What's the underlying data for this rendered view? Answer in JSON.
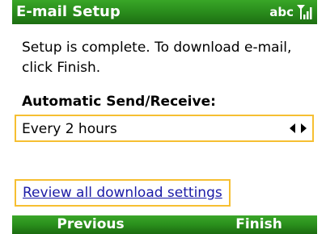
{
  "title_bar": {
    "title": "E-mail Setup",
    "input_mode": "abc",
    "signal_icon": "signal-strength-icon"
  },
  "message": "Setup is complete.  To download e-mail, click Finish.",
  "send_receive": {
    "label": "Automatic Send/Receive:",
    "selected_value": "Every 2 hours",
    "arrows_icon": "left-right-arrows-icon"
  },
  "review_link": "Review all download settings",
  "softkeys": {
    "left": "Previous",
    "right": "Finish"
  },
  "colors": {
    "accent_green": "#2b8f1d",
    "focus_border": "#f6bf32",
    "link": "#1a1aa6"
  }
}
